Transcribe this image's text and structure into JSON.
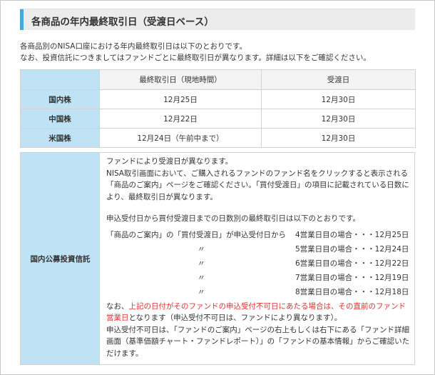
{
  "header": {
    "title": "各商品の年内最終取引日（受渡日ベース）"
  },
  "intro": {
    "line1": "各商品別のNISA口座における年内最終取引日は以下のとおりです。",
    "line2": "なお、投資信託につきましてはファンドごとに最終取引日が異なります。詳細は以下をご確認ください。"
  },
  "table": {
    "columns": [
      "最終取引日（現地時間）",
      "受渡日"
    ],
    "rows": [
      {
        "label": "国内株",
        "last_trade": "12月25日",
        "settlement": "12月30日"
      },
      {
        "label": "中国株",
        "last_trade": "12月22日",
        "settlement": "12月30日"
      },
      {
        "label": "米国株",
        "last_trade": "12月24日（午前中まで）",
        "settlement": "12月30日"
      }
    ]
  },
  "fund": {
    "label": "国内公募投資信託",
    "p1": "ファンドにより受渡日が異なります。",
    "p2": "NISA取引画面において、ご購入されるファンドのファンド名をクリックすると表示される「商品のご案内」ページをご確認ください。「買付受渡日」の項目に記載されている日数により、最終取引日が異なります。",
    "p3": "申込受付日から買付受渡日までの日数別の最終取引日は以下のとおりです。",
    "schedule": [
      {
        "left": "「商品のご案内」の「買付受渡日」が申込受付日から",
        "right": "4営業日目の場合・・・12月25日"
      },
      {
        "left": "〃",
        "right": "5営業日目の場合・・・12月24日"
      },
      {
        "left": "〃",
        "right": "6営業日目の場合・・・12月22日"
      },
      {
        "left": "〃",
        "right": "7営業日目の場合・・・12月19日"
      },
      {
        "left": "〃",
        "right": "8営業日目の場合・・・12月18日"
      }
    ],
    "note_prefix": "なお、",
    "note_red": "上記の日付がそのファンドの申込受付不可日にあたる場合は、その直前のファンド営業日",
    "note_suffix": "となります（申込受付不可日は、ファンドにより異なります）。",
    "p5": "申込受付不可日は、「ファンドのご案内」ページの右上もしくは右下にある「ファンド詳細画面（基準価額チャート・ファンドレポート）」の「ファンドの基本情報」からご確認いただけます。"
  },
  "colors": {
    "accent": "#45a8d6",
    "label_bg": "#bfe3f4",
    "emphasis": "#e03232"
  }
}
